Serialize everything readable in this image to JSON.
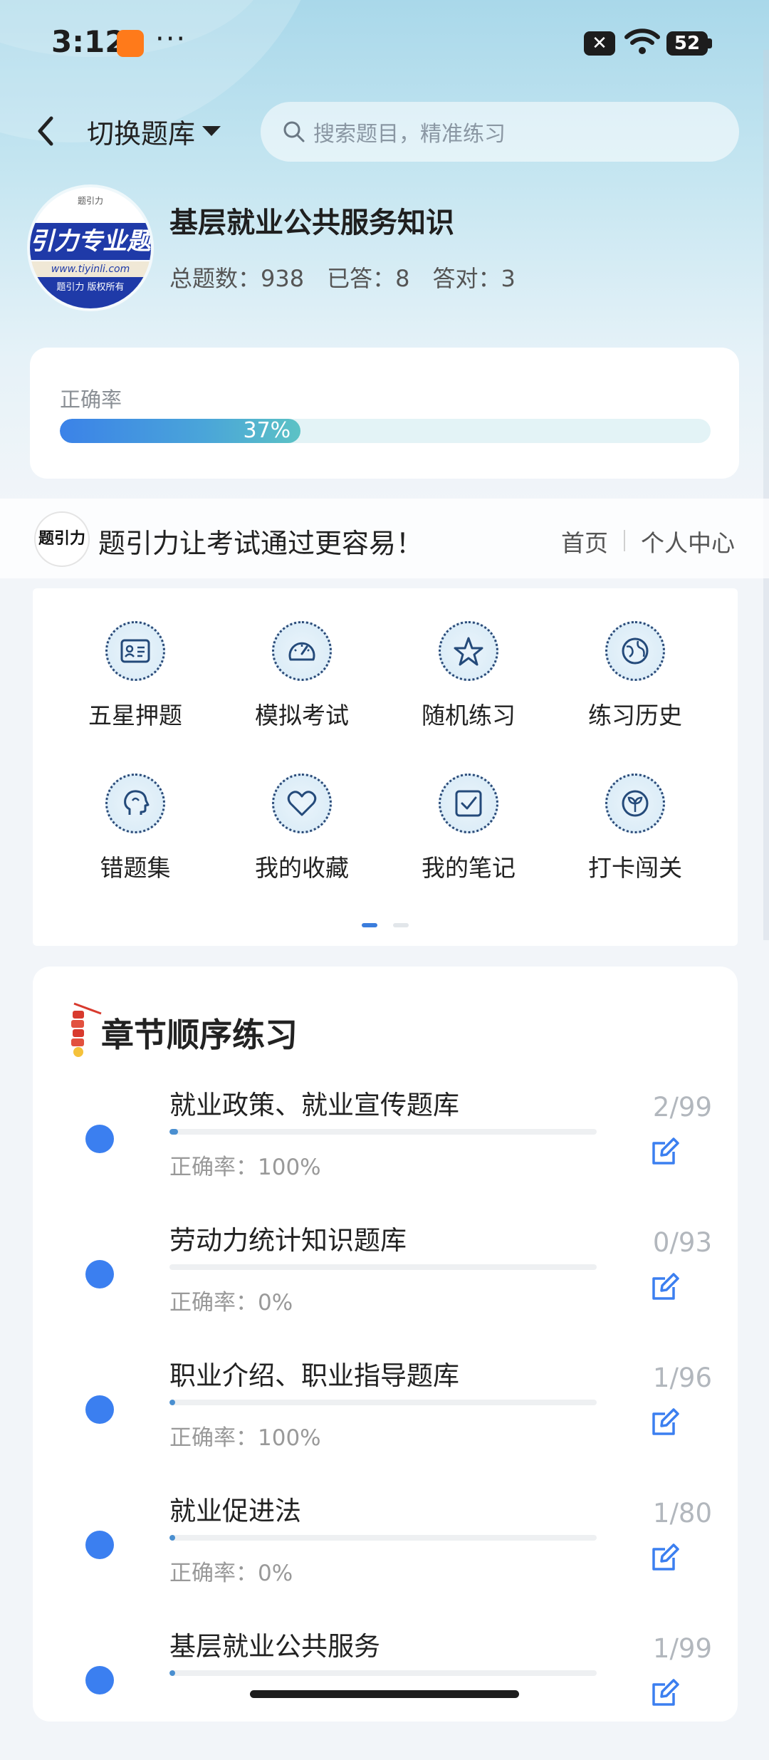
{
  "status": {
    "time": "3:12",
    "dots": "···",
    "battery": "52"
  },
  "header": {
    "switch_label": "切换题库",
    "search_placeholder": "搜索题目，精准练习"
  },
  "bank": {
    "logo_band": "引力专业题",
    "logo_url": "www.tiyinli.com",
    "logo_copy": "题引力 版权所有",
    "logo_top": "题引力",
    "title": "基层就业公共服务知识",
    "total_label": "总题数：938",
    "answered_label": "已答：8",
    "correct_label": "答对：3",
    "total": 938,
    "answered": 8,
    "correct": 3
  },
  "accuracy": {
    "label": "正确率",
    "percent_text": "37%",
    "value": 0.37
  },
  "promo": {
    "logo_text": "题引力",
    "slogan": "题引力让考试通过更容易！",
    "home": "首页",
    "personal": "个人中心"
  },
  "grid": {
    "items": [
      {
        "label": "五星押题",
        "icon": "id-card-icon"
      },
      {
        "label": "模拟考试",
        "icon": "gauge-icon"
      },
      {
        "label": "随机练习",
        "icon": "shuffle-star-icon"
      },
      {
        "label": "练习历史",
        "icon": "globe-icon"
      },
      {
        "label": "错题集",
        "icon": "head-icon"
      },
      {
        "label": "我的收藏",
        "icon": "heart-icon"
      },
      {
        "label": "我的笔记",
        "icon": "checkbox-note-icon"
      },
      {
        "label": "打卡闯关",
        "icon": "sprout-icon"
      }
    ],
    "page": 1,
    "pages": 2
  },
  "chapters": {
    "title": "章节顺序练习",
    "items": [
      {
        "name": "就业政策、就业宣传题库",
        "accuracy": "正确率：100%",
        "count": "2/99",
        "progress": 0.0202
      },
      {
        "name": "劳动力统计知识题库",
        "accuracy": "正确率：0%",
        "count": "0/93",
        "progress": 0
      },
      {
        "name": "职业介绍、职业指导题库",
        "accuracy": "正确率：100%",
        "count": "1/96",
        "progress": 0.0104
      },
      {
        "name": "就业促进法",
        "accuracy": "正确率：0%",
        "count": "1/80",
        "progress": 0.0125
      },
      {
        "name": "基层就业公共服务",
        "accuracy": "",
        "count": "1/99",
        "progress": 0.0101
      }
    ]
  },
  "colors": {
    "accent": "#3b7ff0",
    "progress_start": "#3b82e8",
    "progress_end": "#5cc2c5"
  }
}
